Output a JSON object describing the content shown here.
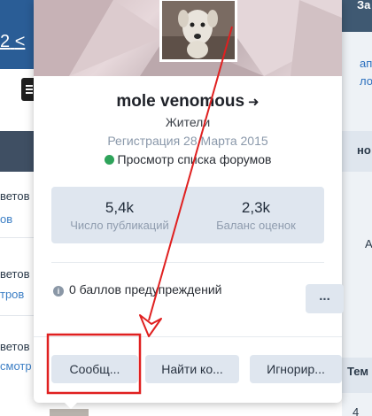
{
  "background": {
    "page_number": "2",
    "page_number_suffix": "<",
    "left_items": [
      {
        "text": "ветов",
        "link": "ов"
      },
      {
        "text": "ветов",
        "link": "тров"
      },
      {
        "text": "ветов",
        "link": "смотр"
      }
    ],
    "right_items": {
      "top": "За",
      "links": [
        "ап",
        "ло"
      ],
      "mid": "но",
      "letter": "A",
      "bottom_head": "Тем",
      "bottom_num": "4"
    }
  },
  "profile_card": {
    "name": "mole venomous",
    "group": "Жители",
    "registered": "Регистрация 28 Марта 2015",
    "status": "Просмотр списка форумов",
    "stats": [
      {
        "value": "5,4k",
        "label": "Число публикаций"
      },
      {
        "value": "2,3k",
        "label": "Баланс оценок"
      }
    ],
    "warning_points": "0 баллов предупреждений",
    "more_label": "...",
    "buttons": {
      "message": "Сообщ...",
      "find": "Найти ко...",
      "ignore": "Игнорир..."
    }
  },
  "colors": {
    "annotation": "#e02020",
    "online": "#2ea35a",
    "accent": "#2a5d96"
  }
}
